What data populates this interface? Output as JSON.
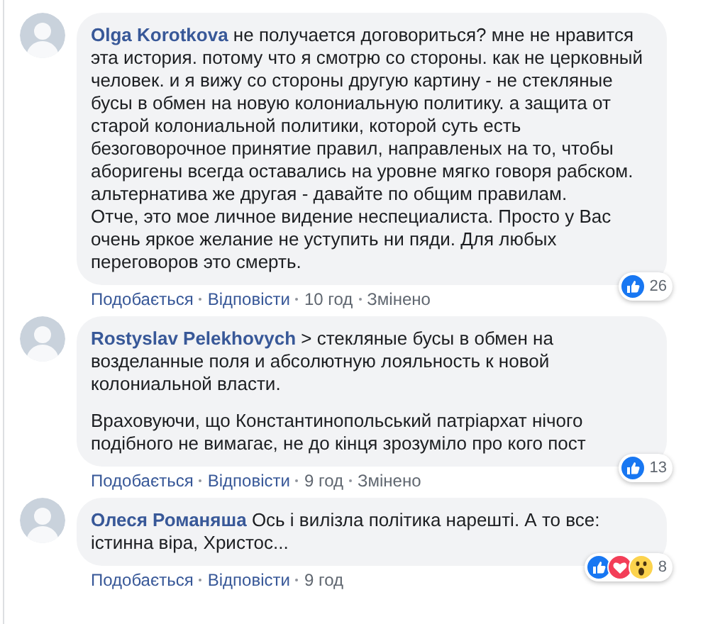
{
  "comments": [
    {
      "author": "Olga Korotkova",
      "paragraphs": [
        "не получается договориться? мне не нравится эта история. потому что я смотрю со стороны. как не церковный человек. и я вижу со стороны другую картину - не стекляные бусы в обмен на новую колониальную политику. а защита от старой колониальной политики, которой суть есть безоговорочное принятие правил, направленых на то, чтобы аборигены всегда оставались на уровне мягко говоря рабском. альтернатива же другая - давайте по общим правилам.\nОтче, это мое личное видение неспециалиста. Просто у Вас очень яркое желание не уступить ни пяди. Для любых переговоров это смерть."
      ],
      "reactions": [
        {
          "kind": "like"
        }
      ],
      "reaction_count": "26",
      "actions": [
        {
          "kind": "link",
          "label": "Подобається"
        },
        {
          "kind": "link",
          "label": "Відповісти"
        },
        {
          "kind": "time",
          "label": "10 год"
        },
        {
          "kind": "edited",
          "label": "Змінено"
        }
      ]
    },
    {
      "author": "Rostyslav Pelekhovych",
      "paragraphs": [
        "> стекляные бусы в обмен на возделанные поля и абсолютную лояльность к новой колониальной власти.",
        "Враховуючи, що Константинопольський патріархат нічого подібного не вимагає, не до кінця зрозуміло про кого пост"
      ],
      "reactions": [
        {
          "kind": "like"
        }
      ],
      "reaction_count": "13",
      "actions": [
        {
          "kind": "link",
          "label": "Подобається"
        },
        {
          "kind": "link",
          "label": "Відповісти"
        },
        {
          "kind": "time",
          "label": "9 год"
        },
        {
          "kind": "edited",
          "label": "Змінено"
        }
      ]
    },
    {
      "author": "Олеся Романяша",
      "paragraphs": [
        "Ось і вилізла політика нарешті. А то все: істинна віра, Христос..."
      ],
      "reactions": [
        {
          "kind": "like"
        },
        {
          "kind": "love"
        },
        {
          "kind": "wow"
        }
      ],
      "reaction_count": "8",
      "actions": [
        {
          "kind": "link",
          "label": "Подобається"
        },
        {
          "kind": "link",
          "label": "Відповісти"
        },
        {
          "kind": "time",
          "label": "9 год"
        }
      ]
    }
  ]
}
